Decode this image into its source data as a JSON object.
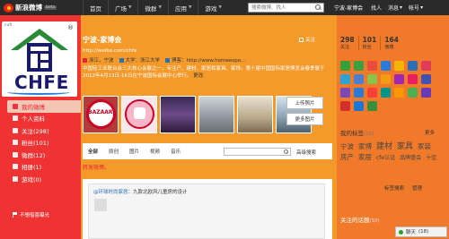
{
  "colors": {
    "left_bg": "#ef3333",
    "mid_bg": "#f39a2a",
    "right_bg": "#f07a2a",
    "topbar": "#2a2a2a",
    "accent_red": "#e22233"
  },
  "topbar": {
    "logo_text": "新浪微博",
    "logo_beta": "beta",
    "nav": [
      {
        "label": "首页",
        "dropdown": false
      },
      {
        "label": "广场",
        "dropdown": true
      },
      {
        "label": "微群",
        "dropdown": true
      },
      {
        "label": "应用",
        "dropdown": true
      },
      {
        "label": "游戏",
        "dropdown": true
      }
    ],
    "search_placeholder": "搜索微博、找人",
    "user_name": "宁波-家博会",
    "links": [
      {
        "label": "找人"
      },
      {
        "label": "消息",
        "dropdown": true
      },
      {
        "label": "帐号",
        "dropdown": true
      }
    ]
  },
  "brand": {
    "mini_text": "cufi",
    "trademark": "®",
    "logo_name": "CHFE"
  },
  "sidebar": {
    "items": [
      {
        "label": "我的微博",
        "icon": "home-icon",
        "active": true
      },
      {
        "label": "个人资料",
        "icon": "profile-icon"
      },
      {
        "label": "关注(298)",
        "icon": "follow-icon"
      },
      {
        "label": "粉丝(101)",
        "icon": "fans-icon"
      },
      {
        "label": "微群(12)",
        "icon": "group-icon"
      },
      {
        "label": "相册(1)",
        "icon": "album-icon"
      },
      {
        "label": "游戏(0)",
        "icon": "game-icon"
      }
    ],
    "bottom": "不想借喜曝光"
  },
  "profile": {
    "name": "宁波-家博会",
    "follow_label": "关注",
    "url": "http://weibo.com/chfe",
    "meta": [
      {
        "icon": "location-icon",
        "text": "浙江，宁波"
      },
      {
        "icon": "school-icon",
        "text": "大学：浙江大学"
      },
      {
        "icon": "blog-icon",
        "text": "博客：http://www.homeexpo..."
      }
    ],
    "description": "中国轻工业联合会三大核心会展之一，专注产、建材、家居和家具、家饰，第十届中国国际家居博览会春季展于2012年4月13日-16日在宁波国际会展中心举行。",
    "more": "更改"
  },
  "photos": [
    {
      "alt": "BAZAAR"
    },
    {
      "alt": "pink logo"
    },
    {
      "alt": "auditorium"
    },
    {
      "alt": "exhibition hall"
    },
    {
      "alt": "furniture"
    },
    {
      "alt": "showroom"
    }
  ],
  "photo_buttons": {
    "upload": "上传照片",
    "more": "更多图片"
  },
  "feed_tabs": [
    {
      "label": "全部",
      "active": true
    },
    {
      "label": "原创"
    },
    {
      "label": "图片"
    },
    {
      "label": "视频"
    },
    {
      "label": "音乐"
    }
  ],
  "feed_search": {
    "placeholder": "",
    "advanced": "高级搜索"
  },
  "forward_notice": "转发微博。",
  "post": {
    "author": "@环球时尚家居",
    "text": "：九款北欧风儿童房的设计"
  },
  "stats": [
    {
      "num": "298",
      "label": "关注"
    },
    {
      "num": "101",
      "label": "粉丝"
    },
    {
      "num": "164",
      "label": "微博"
    }
  ],
  "app_icons": [
    {
      "name": "app-icon-1",
      "color": "#35a035"
    },
    {
      "name": "app-icon-2",
      "color": "#3aa040"
    },
    {
      "name": "app-icon-3",
      "color": "#e84c3c"
    },
    {
      "name": "app-icon-4",
      "color": "#2a7bd8"
    },
    {
      "name": "app-icon-5",
      "color": "#f4b400"
    },
    {
      "name": "app-icon-6",
      "color": "#2a6fb8"
    },
    {
      "name": "app-icon-7",
      "color": "#e23a5a"
    },
    {
      "name": "app-icon-8",
      "color": "#2aa3d8"
    },
    {
      "name": "app-icon-9",
      "color": "#4a7fd8"
    },
    {
      "name": "app-icon-10",
      "color": "#8bc34a"
    },
    {
      "name": "app-icon-11",
      "color": "#f39c12"
    },
    {
      "name": "app-icon-12",
      "color": "#9c27b0"
    },
    {
      "name": "app-icon-13",
      "color": "#e91e63"
    },
    {
      "name": "app-icon-14",
      "color": "#3f51b5"
    },
    {
      "name": "app-icon-15",
      "color": "#7a4ab8"
    },
    {
      "name": "app-icon-16",
      "color": "#2a7bd8"
    },
    {
      "name": "app-icon-17",
      "color": "#f44336"
    },
    {
      "name": "app-icon-18",
      "color": "#009688"
    },
    {
      "name": "app-icon-19",
      "color": "#ff9800"
    },
    {
      "name": "app-icon-20",
      "color": "#4caf50"
    },
    {
      "name": "app-icon-21",
      "color": "#673ab7"
    },
    {
      "name": "app-icon-22",
      "color": "#d32f2f"
    },
    {
      "name": "app-icon-23",
      "color": "#1976d2"
    },
    {
      "name": "app-icon-24",
      "color": "#388e3c"
    }
  ],
  "tags_section": {
    "title": "我的标签",
    "count": "(10)",
    "more": "更多",
    "tags": [
      {
        "label": "宁波",
        "size": "md"
      },
      {
        "label": "家博",
        "size": "md"
      },
      {
        "label": "建材",
        "size": "lg"
      },
      {
        "label": "家具",
        "size": "lg"
      },
      {
        "label": "家装",
        "size": "md"
      },
      {
        "label": "房产",
        "size": "md"
      },
      {
        "label": "家居",
        "size": "md"
      },
      {
        "label": "cfe认证",
        "size": "sm"
      },
      {
        "label": "品牌盛会",
        "size": "sm"
      },
      {
        "label": "十佳",
        "size": "sm"
      }
    ],
    "links": [
      "标签搜索",
      "管理"
    ]
  },
  "topics": {
    "title": "关注的话题",
    "count": "(10)"
  },
  "chat": {
    "label": "聊天",
    "count": "(18)"
  }
}
